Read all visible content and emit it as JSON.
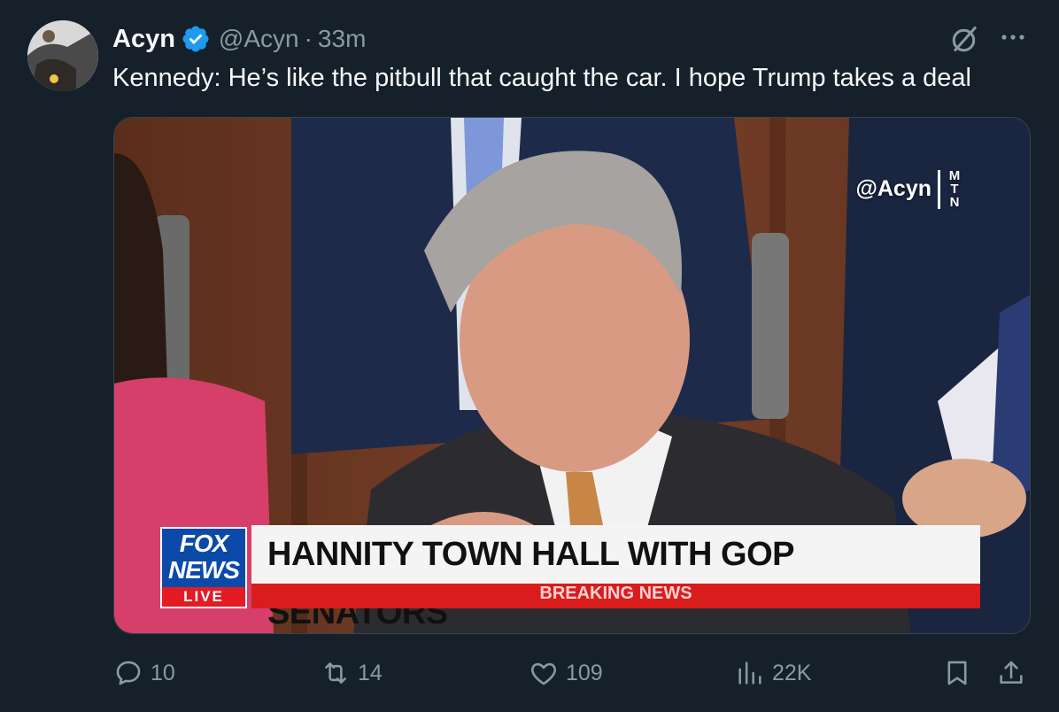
{
  "tweet": {
    "author_name": "Acyn",
    "handle": "@Acyn",
    "separator": "·",
    "time": "33m",
    "text": "Kennedy: He’s like the pitbull that caught the car. I hope Trump takes a deal"
  },
  "media": {
    "watermark_handle": "@Acyn",
    "watermark_logo": [
      "M",
      "T",
      "N"
    ],
    "network_logo_top": "FOX",
    "network_logo_bottom": "NEWS",
    "network_live": "LIVE",
    "banner_headline": "HANNITY TOWN HALL WITH GOP SENATORS",
    "breaking_text": "BREAKING NEWS"
  },
  "actions": {
    "replies": "10",
    "reposts": "14",
    "likes": "109",
    "views": "22K"
  },
  "colors": {
    "background": "#15202b",
    "text_primary": "#f7f9f9",
    "text_secondary": "#8b98a5",
    "verified_blue": "#1d9bf0"
  },
  "icons": [
    "grok-icon",
    "more-icon",
    "reply-icon",
    "repost-icon",
    "like-icon",
    "views-icon",
    "bookmark-icon",
    "share-icon",
    "verified-badge-icon"
  ]
}
